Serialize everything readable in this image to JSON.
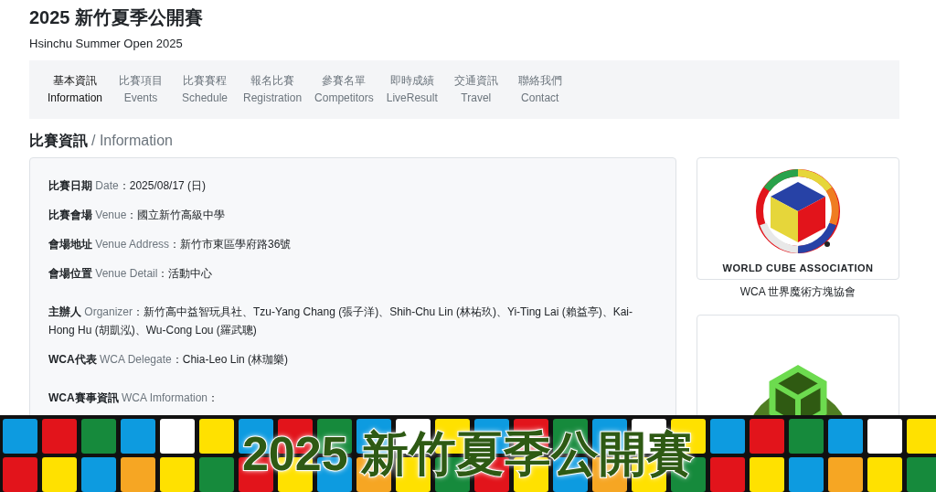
{
  "header": {
    "title": "2025 新竹夏季公開賽",
    "subtitle": "Hsinchu Summer Open 2025"
  },
  "nav": [
    {
      "zh": "基本資訊",
      "en": "Information",
      "selected": true
    },
    {
      "zh": "比賽項目",
      "en": "Events",
      "selected": false
    },
    {
      "zh": "比賽賽程",
      "en": "Schedule",
      "selected": false
    },
    {
      "zh": "報名比賽",
      "en": "Registration",
      "selected": false
    },
    {
      "zh": "參賽名單",
      "en": "Competitors",
      "selected": false
    },
    {
      "zh": "即時成績",
      "en": "LiveResult",
      "selected": false
    },
    {
      "zh": "交通資訊",
      "en": "Travel",
      "selected": false
    },
    {
      "zh": "聯絡我們",
      "en": "Contact",
      "selected": false
    }
  ],
  "section": {
    "title": "比賽資訊",
    "subtitle": "/ Information"
  },
  "info_groups": [
    [
      {
        "label": "比賽日期",
        "en": "Date",
        "sep": "：",
        "value": "2025/08/17 (日)"
      },
      {
        "label": "比賽會場",
        "en": "Venue",
        "sep": "：",
        "value": "國立新竹高級中學"
      },
      {
        "label": "會場地址",
        "en": "Venue Address",
        "sep": "：",
        "value": "新竹市東區學府路36號"
      },
      {
        "label": "會場位置",
        "en": "Venue Detail",
        "sep": "：",
        "value": "活動中心"
      }
    ],
    [
      {
        "label": "主辦人",
        "en": "Organizer",
        "sep": "：",
        "value": "新竹高中益智玩具社、Tzu-Yang Chang (張子洋)、Shih-Chu Lin (林祐玖)、Yi-Ting Lai (賴益亭)、Kai-Hong Hu (胡凱泓)、Wu-Cong Lou (羅武聰)"
      },
      {
        "label": "WCA代表",
        "en": "WCA Delegate",
        "sep": "：",
        "value": "Chia-Leo Lin (林珈樂)"
      }
    ],
    [
      {
        "label": "WCA賽事資訊",
        "en": "WCA Imformation",
        "sep": "："
      }
    ]
  ],
  "sidebar": [
    {
      "kind": "wca",
      "logo_text": "WORLD CUBE ASSOCIATION",
      "caption": "WCA 世界魔術方塊協會"
    },
    {
      "kind": "green"
    }
  ],
  "banner": {
    "title": "2025 新竹夏季公開賽"
  }
}
